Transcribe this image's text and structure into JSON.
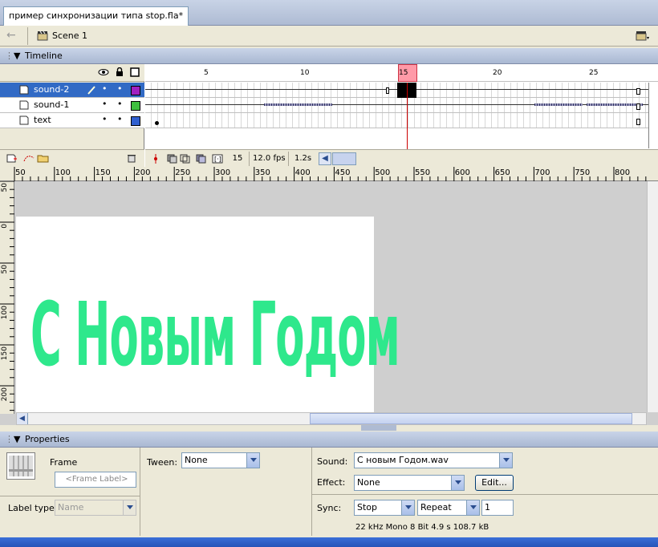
{
  "document": {
    "tab_title": "пример синхронизации типа stop.fla*"
  },
  "scene_bar": {
    "scene_label": "Scene 1"
  },
  "timeline": {
    "panel_title": "Timeline",
    "layers": [
      {
        "name": "sound-2",
        "color": "#a020c0",
        "selected": true
      },
      {
        "name": "sound-1",
        "color": "#40c040",
        "selected": false
      },
      {
        "name": "text",
        "color": "#3060d0",
        "selected": false
      }
    ],
    "frame_ruler": [
      "5",
      "10",
      "15",
      "20",
      "25"
    ],
    "current_frame": "15",
    "frame_rate": "12.0 fps",
    "elapsed_time": "1.2s"
  },
  "stage": {
    "h_ruler": [
      "50",
      "100",
      "150",
      "200",
      "250",
      "300",
      "350",
      "400",
      "450",
      "500",
      "550",
      "600",
      "650",
      "700",
      "750",
      "800"
    ],
    "v_ruler": [
      "50",
      "0",
      "50",
      "100",
      "150",
      "200"
    ],
    "greeting_text": "С Новым Годом",
    "greeting_color": "#2ee88c"
  },
  "properties": {
    "panel_title": "Properties",
    "frame_label": "Frame",
    "frame_label_placeholder": "<Frame Label>",
    "label_type_label": "Label type:",
    "label_type_value": "Name",
    "tween_label": "Tween:",
    "tween_value": "None",
    "sound_label": "Sound:",
    "sound_value": "С новым Годом.wav",
    "effect_label": "Effect:",
    "effect_value": "None",
    "edit_button": "Edit...",
    "sync_label": "Sync:",
    "sync_value": "Stop",
    "repeat_value": "Repeat",
    "repeat_count": "1",
    "sound_info": "22 kHz Mono 8 Bit 4.9 s 108.7 kB"
  }
}
